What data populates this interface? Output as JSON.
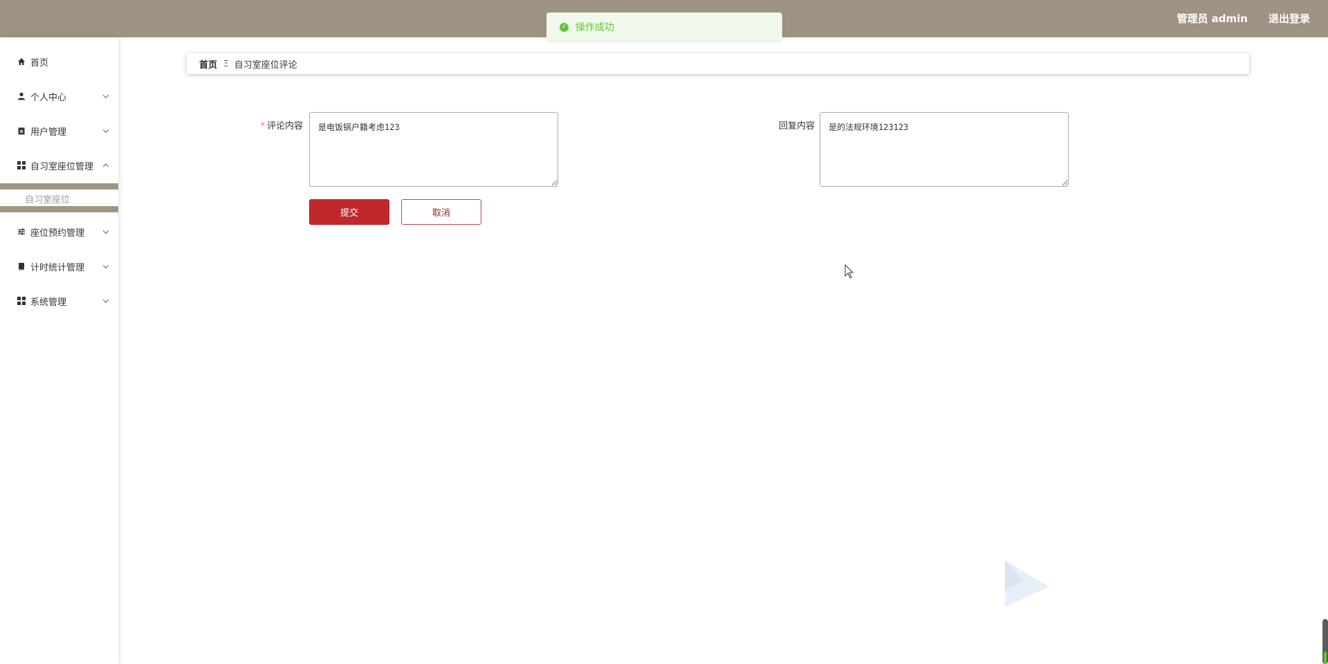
{
  "header": {
    "user_label": "管理员 admin",
    "logout_label": "退出登录",
    "bg_color": "#9f9383"
  },
  "toast": {
    "message": "操作成功",
    "icon": "check-circle-icon",
    "color": "#67c23a"
  },
  "sidebar": {
    "items": [
      {
        "label": "首页",
        "icon": "home-icon"
      },
      {
        "label": "个人中心",
        "icon": "user-icon",
        "expanded": false
      },
      {
        "label": "用户管理",
        "icon": "clipboard-x-icon",
        "expanded": false
      },
      {
        "label": "自习室座位管理",
        "icon": "grid-icon",
        "expanded": true
      },
      {
        "label": "座位预约管理",
        "icon": "sliders-icon",
        "expanded": false
      },
      {
        "label": "计时统计管理",
        "icon": "book-icon",
        "expanded": false
      },
      {
        "label": "系统管理",
        "icon": "grid-icon",
        "expanded": false
      }
    ],
    "subitems": [
      {
        "label": "自习室座位"
      }
    ]
  },
  "breadcrumb": {
    "home": "首页",
    "separator": "Ξ",
    "current": "自习室座位评论"
  },
  "form": {
    "comment_label": "评论内容",
    "comment_required_mark": "*",
    "comment_value": "是电饭锅户籍考虑123",
    "reply_label": "回复内容",
    "reply_value": "是的法规环境123123",
    "submit_label": "提交",
    "cancel_label": "取消"
  },
  "colors": {
    "accent": "#c1272d",
    "sidebar_active": "#a09684"
  }
}
